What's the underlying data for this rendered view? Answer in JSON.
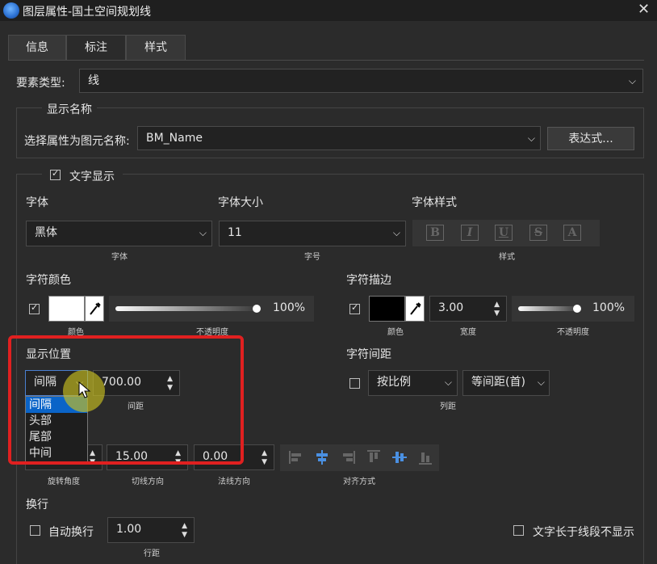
{
  "window": {
    "title": "图层属性-国土空间规划线"
  },
  "tabs": [
    {
      "label": "信息"
    },
    {
      "label": "标注"
    },
    {
      "label": "样式"
    }
  ],
  "feature_type": {
    "label": "要素类型:",
    "value": "线"
  },
  "display_name": {
    "group_label": "显示名称",
    "field_label": "选择属性为图元名称:",
    "field_value": "BM_Name",
    "expr_button": "表达式..."
  },
  "text_display": {
    "label": "文字显示",
    "checked": true,
    "font": {
      "label": "字体",
      "value": "黑体",
      "caption": "字体"
    },
    "font_size": {
      "label": "字体大小",
      "value": "11",
      "caption": "字号"
    },
    "font_style": {
      "label": "字体样式",
      "caption": "样式",
      "buttons": [
        "B",
        "I",
        "U",
        "S",
        "A"
      ]
    },
    "font_color": {
      "label": "字符颜色",
      "checked": true,
      "color": "#ffffff",
      "color_caption": "颜色",
      "opacity": "100%",
      "opacity_value": 1.0,
      "opacity_caption": "不透明度"
    },
    "stroke": {
      "label": "字符描边",
      "checked": true,
      "color": "#000000",
      "color_caption": "颜色",
      "width": "3.00",
      "width_caption": "宽度",
      "opacity": "100%",
      "opacity_value": 1.0,
      "opacity_caption": "不透明度"
    }
  },
  "position": {
    "label": "显示位置",
    "mode_value": "间隔",
    "interval_value": "700.00",
    "interval_caption": "间距",
    "dropdown_options": [
      "间隔",
      "头部",
      "尾部",
      "中间"
    ],
    "selected_option": "间隔"
  },
  "spacing": {
    "label": "字符间距",
    "checked": false,
    "mode_value": "按比例",
    "type_value": "等间距(首)",
    "caption": "列距"
  },
  "rotation": {
    "rotation_caption": "旋转角度",
    "tangent_value": "15.00",
    "tangent_caption": "切线方向",
    "normal_value": "0.00",
    "normal_caption": "法线方向",
    "align_caption": "对齐方式"
  },
  "wrap": {
    "label": "换行",
    "auto_wrap_label": "自动换行",
    "auto_wrap_checked": false,
    "line_spacing_value": "1.00",
    "line_spacing_caption": "行距",
    "hide_long_label": "文字长于线段不显示",
    "hide_long_checked": false
  },
  "colors": {
    "highlight": "#e02020",
    "selection": "#0a64c8",
    "cursor_glow": "#c9c020"
  }
}
